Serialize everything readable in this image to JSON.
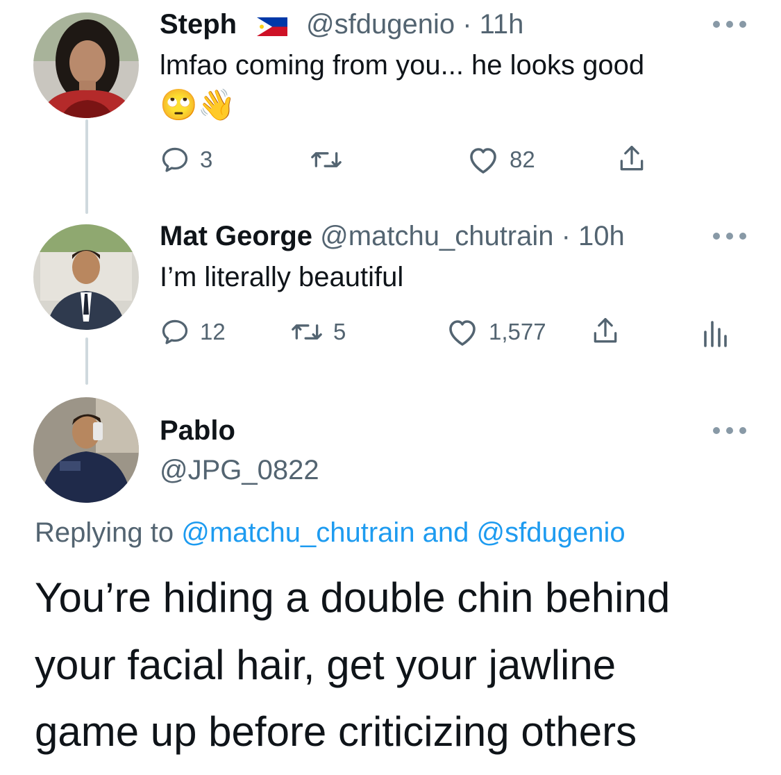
{
  "tweets": [
    {
      "name": "Steph",
      "handle": "@sfdugenio",
      "time": "11h",
      "text": "lmfao coming from you... he looks good",
      "emoji": "🙄👋",
      "replies": "3",
      "retweets": "",
      "likes": "82",
      "flag_icon": "philippines-flag-icon"
    },
    {
      "name": "Mat George",
      "handle": "@matchu_chutrain",
      "time": "10h",
      "text": "I’m literally beautiful",
      "replies": "12",
      "retweets": "5",
      "likes": "1,577"
    }
  ],
  "main_tweet": {
    "name": "Pablo",
    "handle": "@JPG_0822",
    "replying_prefix": "Replying to ",
    "replying_to": "@matchu_chutrain and @sfdugenio",
    "text_lines": [
      "You’re hiding a double chin behind",
      "your facial hair, get your jawline",
      "game up before criticizing others"
    ]
  },
  "separator": " · ",
  "colors": {
    "text": "#0f1419",
    "secondary": "#536471",
    "link": "#1d9bf0",
    "thread_line": "#cfd9de"
  }
}
